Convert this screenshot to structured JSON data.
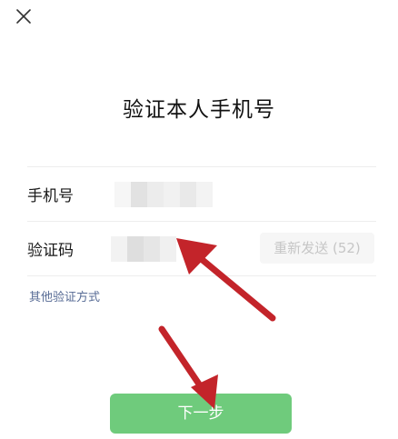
{
  "window": {
    "close_icon": "close-icon"
  },
  "title": "验证本人手机号",
  "form": {
    "phone_label": "手机号",
    "code_label": "验证码",
    "resend_label": "重新发送 (52)"
  },
  "other_methods_label": "其他验证方式",
  "next_label": "下一步",
  "colors": {
    "primary_green": "#6fcb7c",
    "link_blue": "#576b95",
    "annotation_red": "#c3242a",
    "disabled_text": "#c6c6c6"
  }
}
